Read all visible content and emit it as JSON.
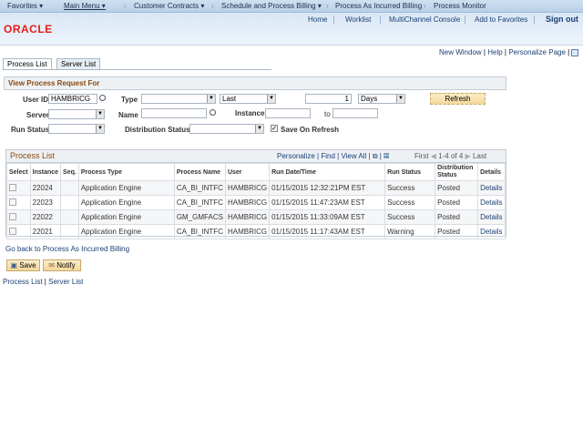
{
  "topnav": {
    "favorites": "Favorites ▾",
    "main_menu": "Main Menu ▾",
    "crumbs": [
      "Customer Contracts ▾",
      "Schedule and Process Billing ▾",
      "Process As Incurred Billing",
      "Process Monitor"
    ]
  },
  "header": {
    "logo": "ORACLE",
    "links": [
      "Home",
      "Worklist",
      "MultiChannel Console",
      "Add to Favorites"
    ],
    "signout": "Sign out"
  },
  "pagelinks": {
    "new_window": "New Window",
    "help": "Help",
    "personalize": "Personalize Page"
  },
  "tabs": [
    "Process List",
    "Server List"
  ],
  "filters": {
    "title": "View Process Request For",
    "user_id_label": "User ID",
    "user_id": "HAMBRICG",
    "type_label": "Type",
    "type": "",
    "last": "Last",
    "count": "1",
    "unit": "Days",
    "refresh": "Refresh",
    "server_label": "Server",
    "server": "",
    "name_label": "Name",
    "name": "",
    "instance_label": "Instance",
    "instance_from": "",
    "to_label": "to",
    "instance_to": "",
    "run_status_label": "Run Status",
    "run_status": "",
    "dist_status_label": "Distribution Status",
    "dist_status": "",
    "save_on_refresh": "Save On Refresh",
    "save_on_refresh_checked": true
  },
  "grid": {
    "title": "Process List",
    "personalize": "Personalize",
    "find": "Find",
    "view_all": "View All",
    "first": "First",
    "range": "1-4 of 4",
    "last": "Last",
    "columns": [
      "Select",
      "Instance",
      "Seq.",
      "Process Type",
      "Process Name",
      "User",
      "Run Date/Time",
      "Run Status",
      "Distribution Status",
      "Details"
    ],
    "rows": [
      {
        "instance": "22024",
        "seq": "",
        "type": "Application Engine",
        "name": "CA_BI_INTFC",
        "user": "HAMBRICG",
        "date": "01/15/2015 12:32:21PM EST",
        "status": "Success",
        "dist": "Posted",
        "details": "Details"
      },
      {
        "instance": "22023",
        "seq": "",
        "type": "Application Engine",
        "name": "CA_BI_INTFC",
        "user": "HAMBRICG",
        "date": "01/15/2015 11:47:23AM EST",
        "status": "Success",
        "dist": "Posted",
        "details": "Details"
      },
      {
        "instance": "22022",
        "seq": "",
        "type": "Application Engine",
        "name": "GM_GMFACS",
        "user": "HAMBRICG",
        "date": "01/15/2015 11:33:09AM EST",
        "status": "Success",
        "dist": "Posted",
        "details": "Details"
      },
      {
        "instance": "22021",
        "seq": "",
        "type": "Application Engine",
        "name": "CA_BI_INTFC",
        "user": "HAMBRICG",
        "date": "01/15/2015 11:17:43AM EST",
        "status": "Warning",
        "dist": "Posted",
        "details": "Details"
      }
    ]
  },
  "goback": "Go back to Process As Incurred Billing",
  "buttons": {
    "save": "Save",
    "notify": "Notify"
  },
  "footer": {
    "process_list": "Process List",
    "server_list": "Server List"
  }
}
